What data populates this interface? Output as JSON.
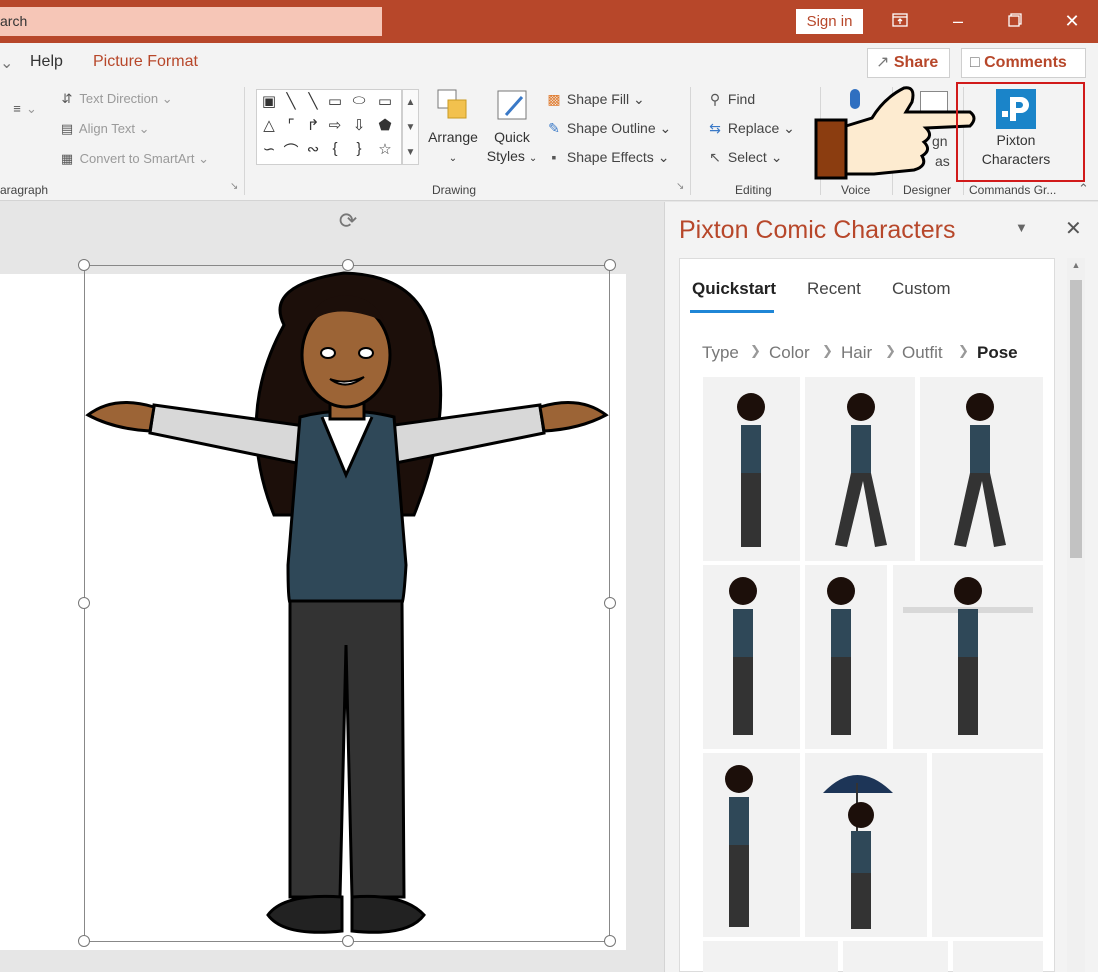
{
  "titlebar": {
    "search_text": "arch",
    "signin": "Sign in"
  },
  "tabs": {
    "help": "Help",
    "picture_format": "Picture Format",
    "share": "Share",
    "comments": "Comments"
  },
  "paragraph": {
    "text_direction": "Text Direction",
    "align_text": "Align Text",
    "convert": "Convert to SmartArt",
    "label": "aragraph"
  },
  "drawing": {
    "arrange": "Arrange",
    "quick": "Quick",
    "styles": "Styles",
    "shape_fill": "Shape Fill",
    "shape_outline": "Shape Outline",
    "shape_effects": "Shape Effects",
    "label": "Drawing"
  },
  "editing": {
    "find": "Find",
    "replace": "Replace",
    "select": "Select",
    "label": "Editing"
  },
  "voice": {
    "label": "Voice"
  },
  "designer": {
    "partial_top": "gn",
    "partial_bottom": "as",
    "label": "Designer"
  },
  "commands": {
    "pixton": "Pixton",
    "characters": "Characters",
    "label": "Commands Gr..."
  },
  "pane": {
    "title": "Pixton Comic Characters",
    "tabs": [
      "Quickstart",
      "Recent",
      "Custom"
    ],
    "breadcrumb": [
      "Type",
      "Color",
      "Hair",
      "Outfit",
      "Pose"
    ]
  },
  "colors": {
    "accent": "#b7472a",
    "tab_underline": "#1f86d6",
    "highlight": "#d11a1a"
  }
}
